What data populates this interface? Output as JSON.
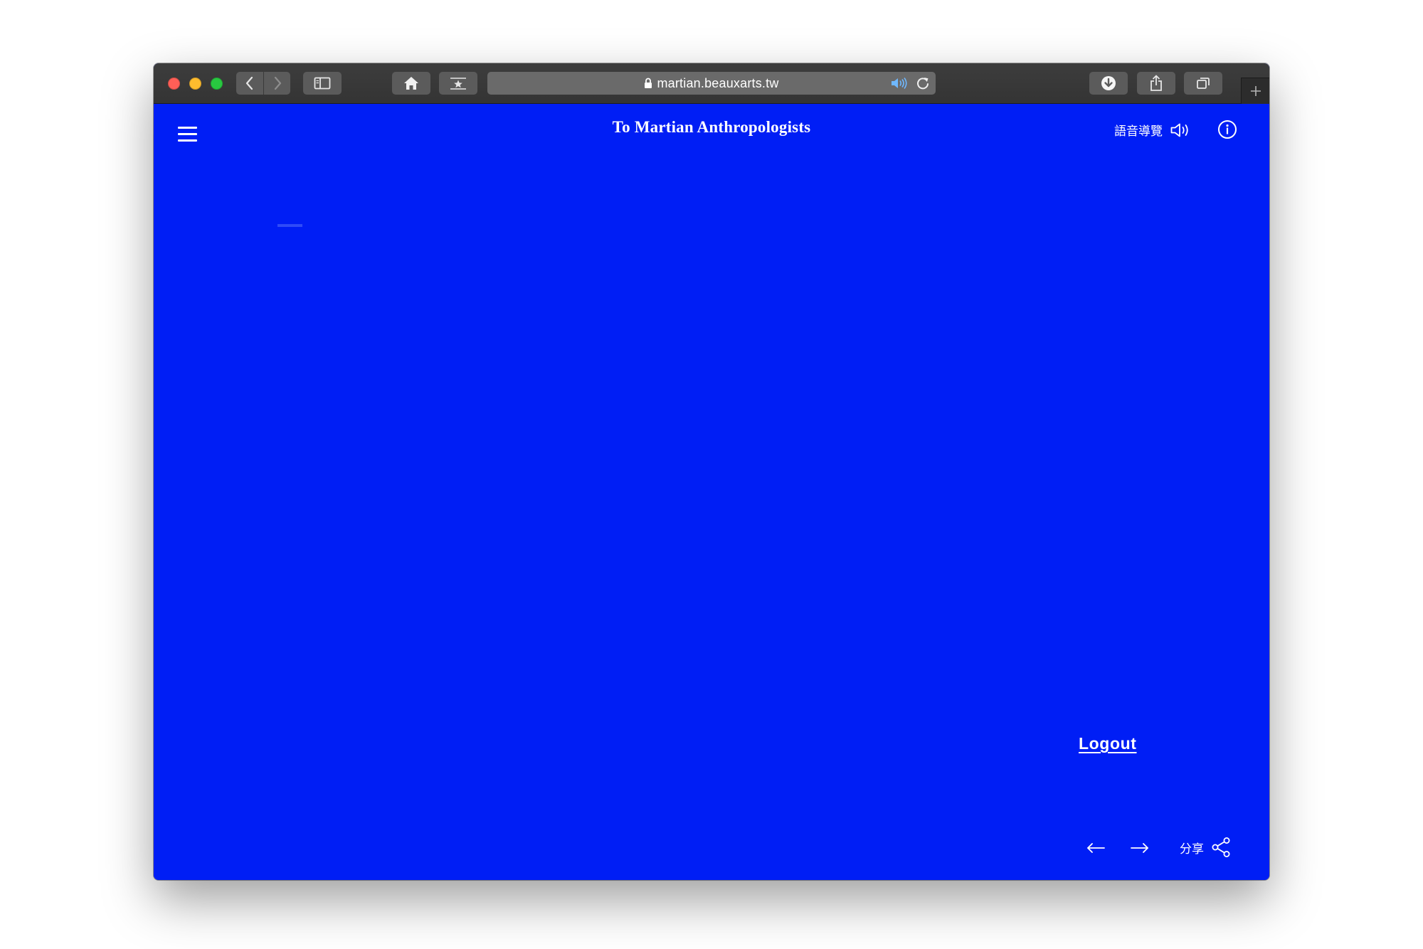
{
  "browser": {
    "url": "martian.beauxarts.tw",
    "icons": {
      "back": "chevron-left-icon",
      "forward": "chevron-right-icon",
      "sidebar": "sidebar-icon",
      "home": "home-icon",
      "reader": "star-bookmark-icon",
      "lock": "lock-icon",
      "audio": "speaker-icon",
      "reload": "reload-icon",
      "download": "download-icon",
      "share": "share-icon",
      "tabs": "tabs-overview-icon",
      "new_tab": "plus-icon"
    }
  },
  "header": {
    "title": "To Martian Anthropologists",
    "audio_guide_label": "語音導覽",
    "menu_icon": "hamburger-menu-icon",
    "audio_icon": "speaker-icon",
    "info_icon": "info-icon"
  },
  "main": {
    "logout_label": "Logout"
  },
  "footer": {
    "share_label": "分享",
    "prev_icon": "arrow-left-icon",
    "next_icon": "arrow-right-icon",
    "share_icon": "share-nodes-icon"
  },
  "colors": {
    "page_background": "#001ef5",
    "text": "#ffffff",
    "toolbar": "#3a3a3a",
    "close": "#fe5f57",
    "minimize": "#febc2e",
    "maximize": "#28c840"
  }
}
